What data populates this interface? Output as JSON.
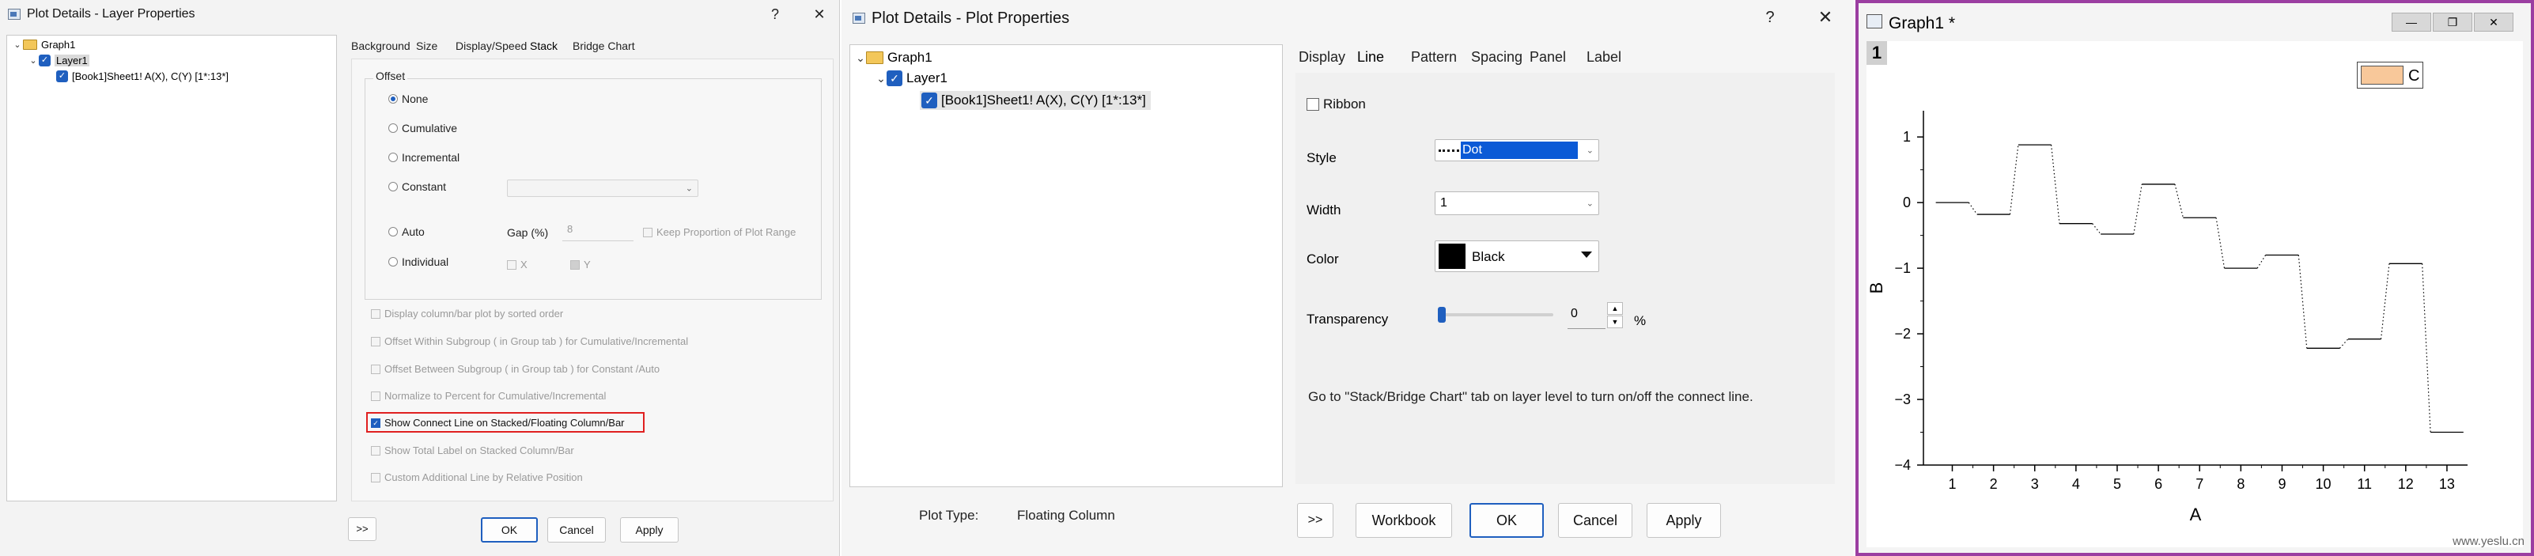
{
  "win1": {
    "title": "Plot Details - Layer Properties",
    "help": "?",
    "close": "✕",
    "tree": {
      "graph": "Graph1",
      "layer": "Layer1",
      "plot": "[Book1]Sheet1! A(X), C(Y) [1*:13*]"
    },
    "tabs": [
      "Background",
      "Size",
      "Display/Speed",
      "Stack",
      "Bridge Chart"
    ],
    "group_title": "Offset",
    "radios": {
      "none": "None",
      "cumulative": "Cumulative",
      "incremental": "Incremental",
      "constant": "Constant",
      "auto": "Auto",
      "individual": "Individual"
    },
    "gap_label": "Gap (%)",
    "gap_value": "8",
    "keep_proportion": "Keep Proportion of Plot Range",
    "x_label": "X",
    "y_label": "Y",
    "options": [
      "Display column/bar plot by sorted order",
      "Offset Within Subgroup ( in Group tab ) for Cumulative/Incremental",
      "Offset Between Subgroup ( in Group tab ) for Constant /Auto",
      "Normalize to Percent for Cumulative/Incremental",
      "Show Connect Line on Stacked/Floating Column/Bar",
      "Show Total Label on Stacked Column/Bar",
      "Custom Additional Line by Relative Position"
    ],
    "buttons": {
      "more": ">>",
      "ok": "OK",
      "cancel": "Cancel",
      "apply": "Apply"
    }
  },
  "win2": {
    "title": "Plot Details - Plot Properties",
    "help": "?",
    "close": "✕",
    "tree": {
      "graph": "Graph1",
      "layer": "Layer1",
      "plot": "[Book1]Sheet1! A(X), C(Y) [1*:13*]"
    },
    "tabs": [
      "Display",
      "Line",
      "Pattern",
      "Spacing",
      "Panel",
      "Label"
    ],
    "ribbon": "Ribbon",
    "style_label": "Style",
    "style_value": "Dot",
    "width_label": "Width",
    "width_value": "1",
    "color_label": "Color",
    "color_value": "Black",
    "transparency_label": "Transparency",
    "transparency_value": "0",
    "transparency_unit": "%",
    "note": "Go to \"Stack/Bridge Chart\" tab on layer level to turn on/off the connect line.",
    "plot_type_label": "Plot Type:",
    "plot_type_value": "Floating Column",
    "buttons": {
      "more": ">>",
      "workbook": "Workbook",
      "ok": "OK",
      "cancel": "Cancel",
      "apply": "Apply"
    }
  },
  "graph": {
    "title": "Graph1 *",
    "layer_num": "1",
    "legend": "C",
    "watermark": "www.yeslu.cn",
    "accent": "#9b3ea1",
    "legend_color": "#f8c89a"
  },
  "chart_data": {
    "type": "bar",
    "subtype": "floating column with dotted connect lines",
    "xlabel": "A",
    "ylabel": "B",
    "xlim": [
      0.3,
      13.5
    ],
    "ylim": [
      -4,
      1.4
    ],
    "x_ticks": [
      "1",
      "2",
      "3",
      "4",
      "5",
      "6",
      "7",
      "8",
      "9",
      "10",
      "11",
      "12",
      "13"
    ],
    "y_ticks": [
      "1",
      "0",
      "−1",
      "−2",
      "−3",
      "−4"
    ],
    "x": [
      1,
      2,
      3,
      4,
      5,
      6,
      7,
      8,
      9,
      10,
      11,
      12,
      13
    ],
    "values": [
      0.0,
      -0.18,
      0.88,
      -0.32,
      -0.48,
      0.28,
      -0.23,
      -1.0,
      -0.8,
      -2.22,
      -2.08,
      -0.93,
      -3.5
    ],
    "series": [
      {
        "name": "C",
        "values": [
          0.0,
          -0.18,
          0.88,
          -0.32,
          -0.48,
          0.28,
          -0.23,
          -1.0,
          -0.8,
          -2.22,
          -2.08,
          -0.93,
          -3.5
        ]
      }
    ]
  }
}
